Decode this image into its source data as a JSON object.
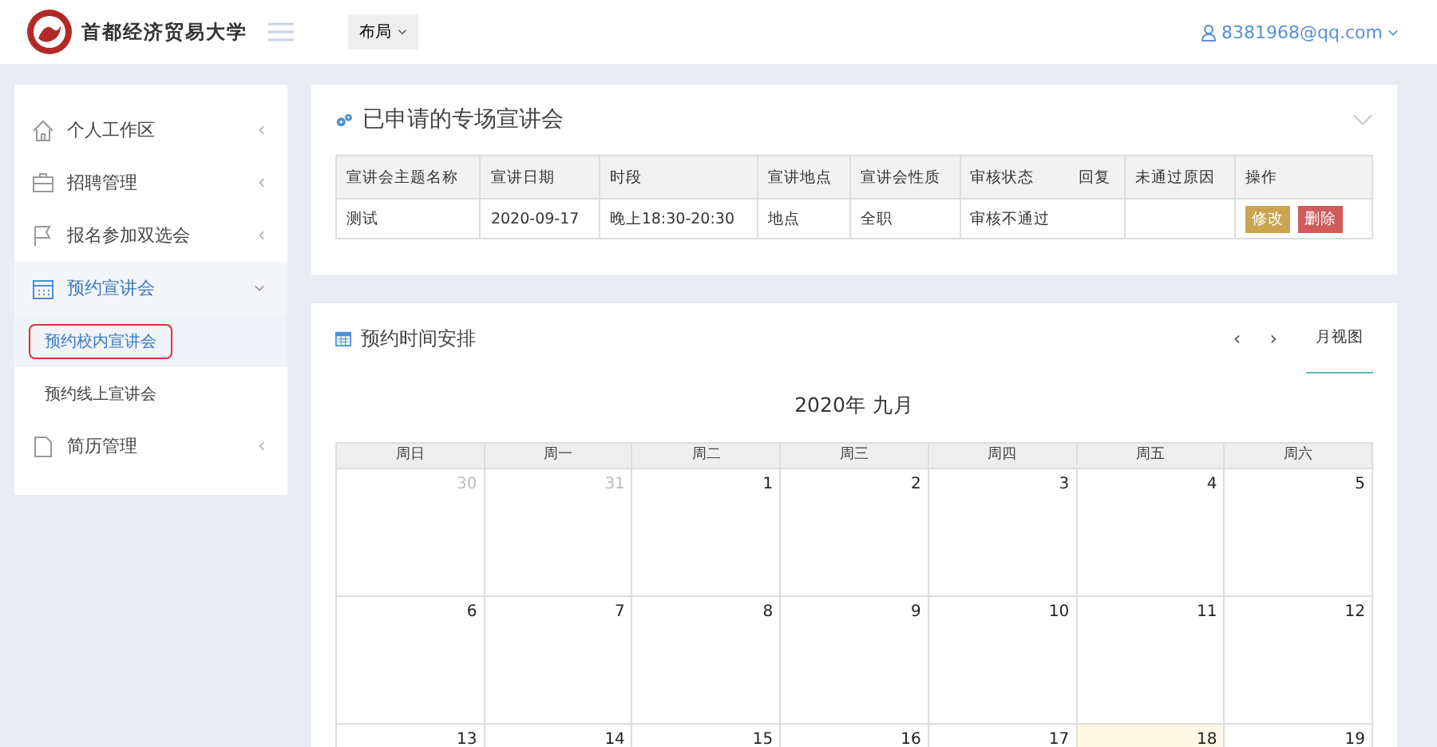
{
  "header": {
    "logo_title": "首都经济贸易大学",
    "layout_button": "布局",
    "user": "8381968@qq.com"
  },
  "sidebar": {
    "items": [
      {
        "label": "个人工作区",
        "kind": "home",
        "expanded": false
      },
      {
        "label": "招聘管理",
        "kind": "briefcase",
        "expanded": false
      },
      {
        "label": "报名参加双选会",
        "kind": "flag",
        "expanded": false
      },
      {
        "label": "预约宣讲会",
        "kind": "calendar",
        "expanded": true,
        "children": [
          {
            "label": "预约校内宣讲会",
            "selected": true
          },
          {
            "label": "预约线上宣讲会",
            "selected": false
          }
        ]
      },
      {
        "label": "简历管理",
        "kind": "file",
        "expanded": false
      }
    ]
  },
  "applied_panel": {
    "title": "已申请的专场宣讲会",
    "table": {
      "columns": [
        "宣讲会主题名称",
        "宣讲日期",
        "时段",
        "宣讲地点",
        "宣讲会性质",
        "审核状态",
        "回复",
        "未通过原因",
        "操作"
      ],
      "rows": [
        {
          "cells": [
            "测试",
            "2020-09-17",
            "晚上18:30-20:30",
            "地点",
            "全职",
            "审核不通过"
          ],
          "actions": [
            {
              "label": "修改",
              "kind": "edit"
            },
            {
              "label": "删除",
              "kind": "delete"
            }
          ]
        }
      ]
    }
  },
  "schedule_panel": {
    "title": "预约时间安排",
    "prev": "‹",
    "next": "›",
    "views": [
      {
        "label": "月视图",
        "selected": true
      }
    ],
    "calendar": {
      "title": "2020年 九月",
      "weekdays": [
        "周日",
        "周一",
        "周二",
        "周三",
        "周四",
        "周五",
        "周六"
      ],
      "weeks": [
        [
          {
            "day": "30",
            "other_month": true,
            "today": false
          },
          {
            "day": "31",
            "other_month": true,
            "today": false
          },
          {
            "day": "1",
            "other_month": false,
            "today": false
          },
          {
            "day": "2",
            "other_month": false,
            "today": false
          },
          {
            "day": "3",
            "other_month": false,
            "today": false
          },
          {
            "day": "4",
            "other_month": false,
            "today": false
          },
          {
            "day": "5",
            "other_month": false,
            "today": false
          }
        ],
        [
          {
            "day": "6",
            "other_month": false,
            "today": false
          },
          {
            "day": "7",
            "other_month": false,
            "today": false
          },
          {
            "day": "8",
            "other_month": false,
            "today": false
          },
          {
            "day": "9",
            "other_month": false,
            "today": false
          },
          {
            "day": "10",
            "other_month": false,
            "today": false
          },
          {
            "day": "11",
            "other_month": false,
            "today": false
          },
          {
            "day": "12",
            "other_month": false,
            "today": false
          }
        ],
        [
          {
            "day": "13",
            "other_month": false,
            "today": false
          },
          {
            "day": "14",
            "other_month": false,
            "today": false
          },
          {
            "day": "15",
            "other_month": false,
            "today": false
          },
          {
            "day": "16",
            "other_month": false,
            "today": false
          },
          {
            "day": "17",
            "other_month": false,
            "today": false
          },
          {
            "day": "18",
            "other_month": false,
            "today": true
          },
          {
            "day": "19",
            "other_month": false,
            "today": false
          }
        ]
      ]
    }
  }
}
